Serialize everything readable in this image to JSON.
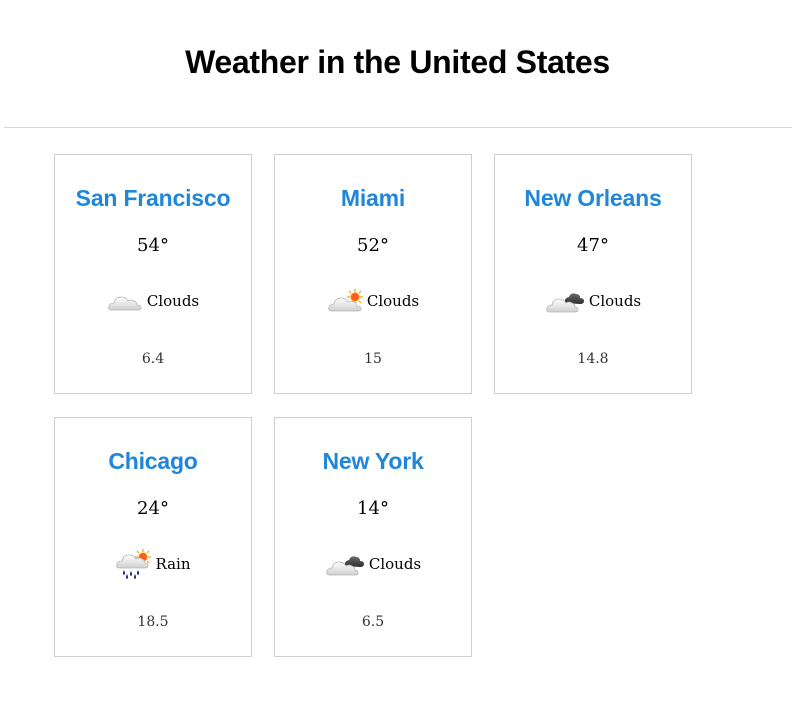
{
  "page": {
    "title": "Weather in the United States"
  },
  "cities": [
    {
      "name": "San Francisco",
      "temp": "54°",
      "condition": "Clouds",
      "icon": "cloud-icon",
      "wind": "6.4"
    },
    {
      "name": "Miami",
      "temp": "52°",
      "condition": "Clouds",
      "icon": "sun-behind-cloud-icon",
      "wind": "15"
    },
    {
      "name": "New Orleans",
      "temp": "47°",
      "condition": "Clouds",
      "icon": "dark-clouds-icon",
      "wind": "14.8"
    },
    {
      "name": "Chicago",
      "temp": "24°",
      "condition": "Rain",
      "icon": "sun-rain-icon",
      "wind": "18.5"
    },
    {
      "name": "New York",
      "temp": "14°",
      "condition": "Clouds",
      "icon": "dark-clouds-icon",
      "wind": "6.5"
    }
  ],
  "colors": {
    "city_name": "#1f86d9",
    "card_border": "#cfcfcf",
    "divider": "#d6d6d6"
  }
}
